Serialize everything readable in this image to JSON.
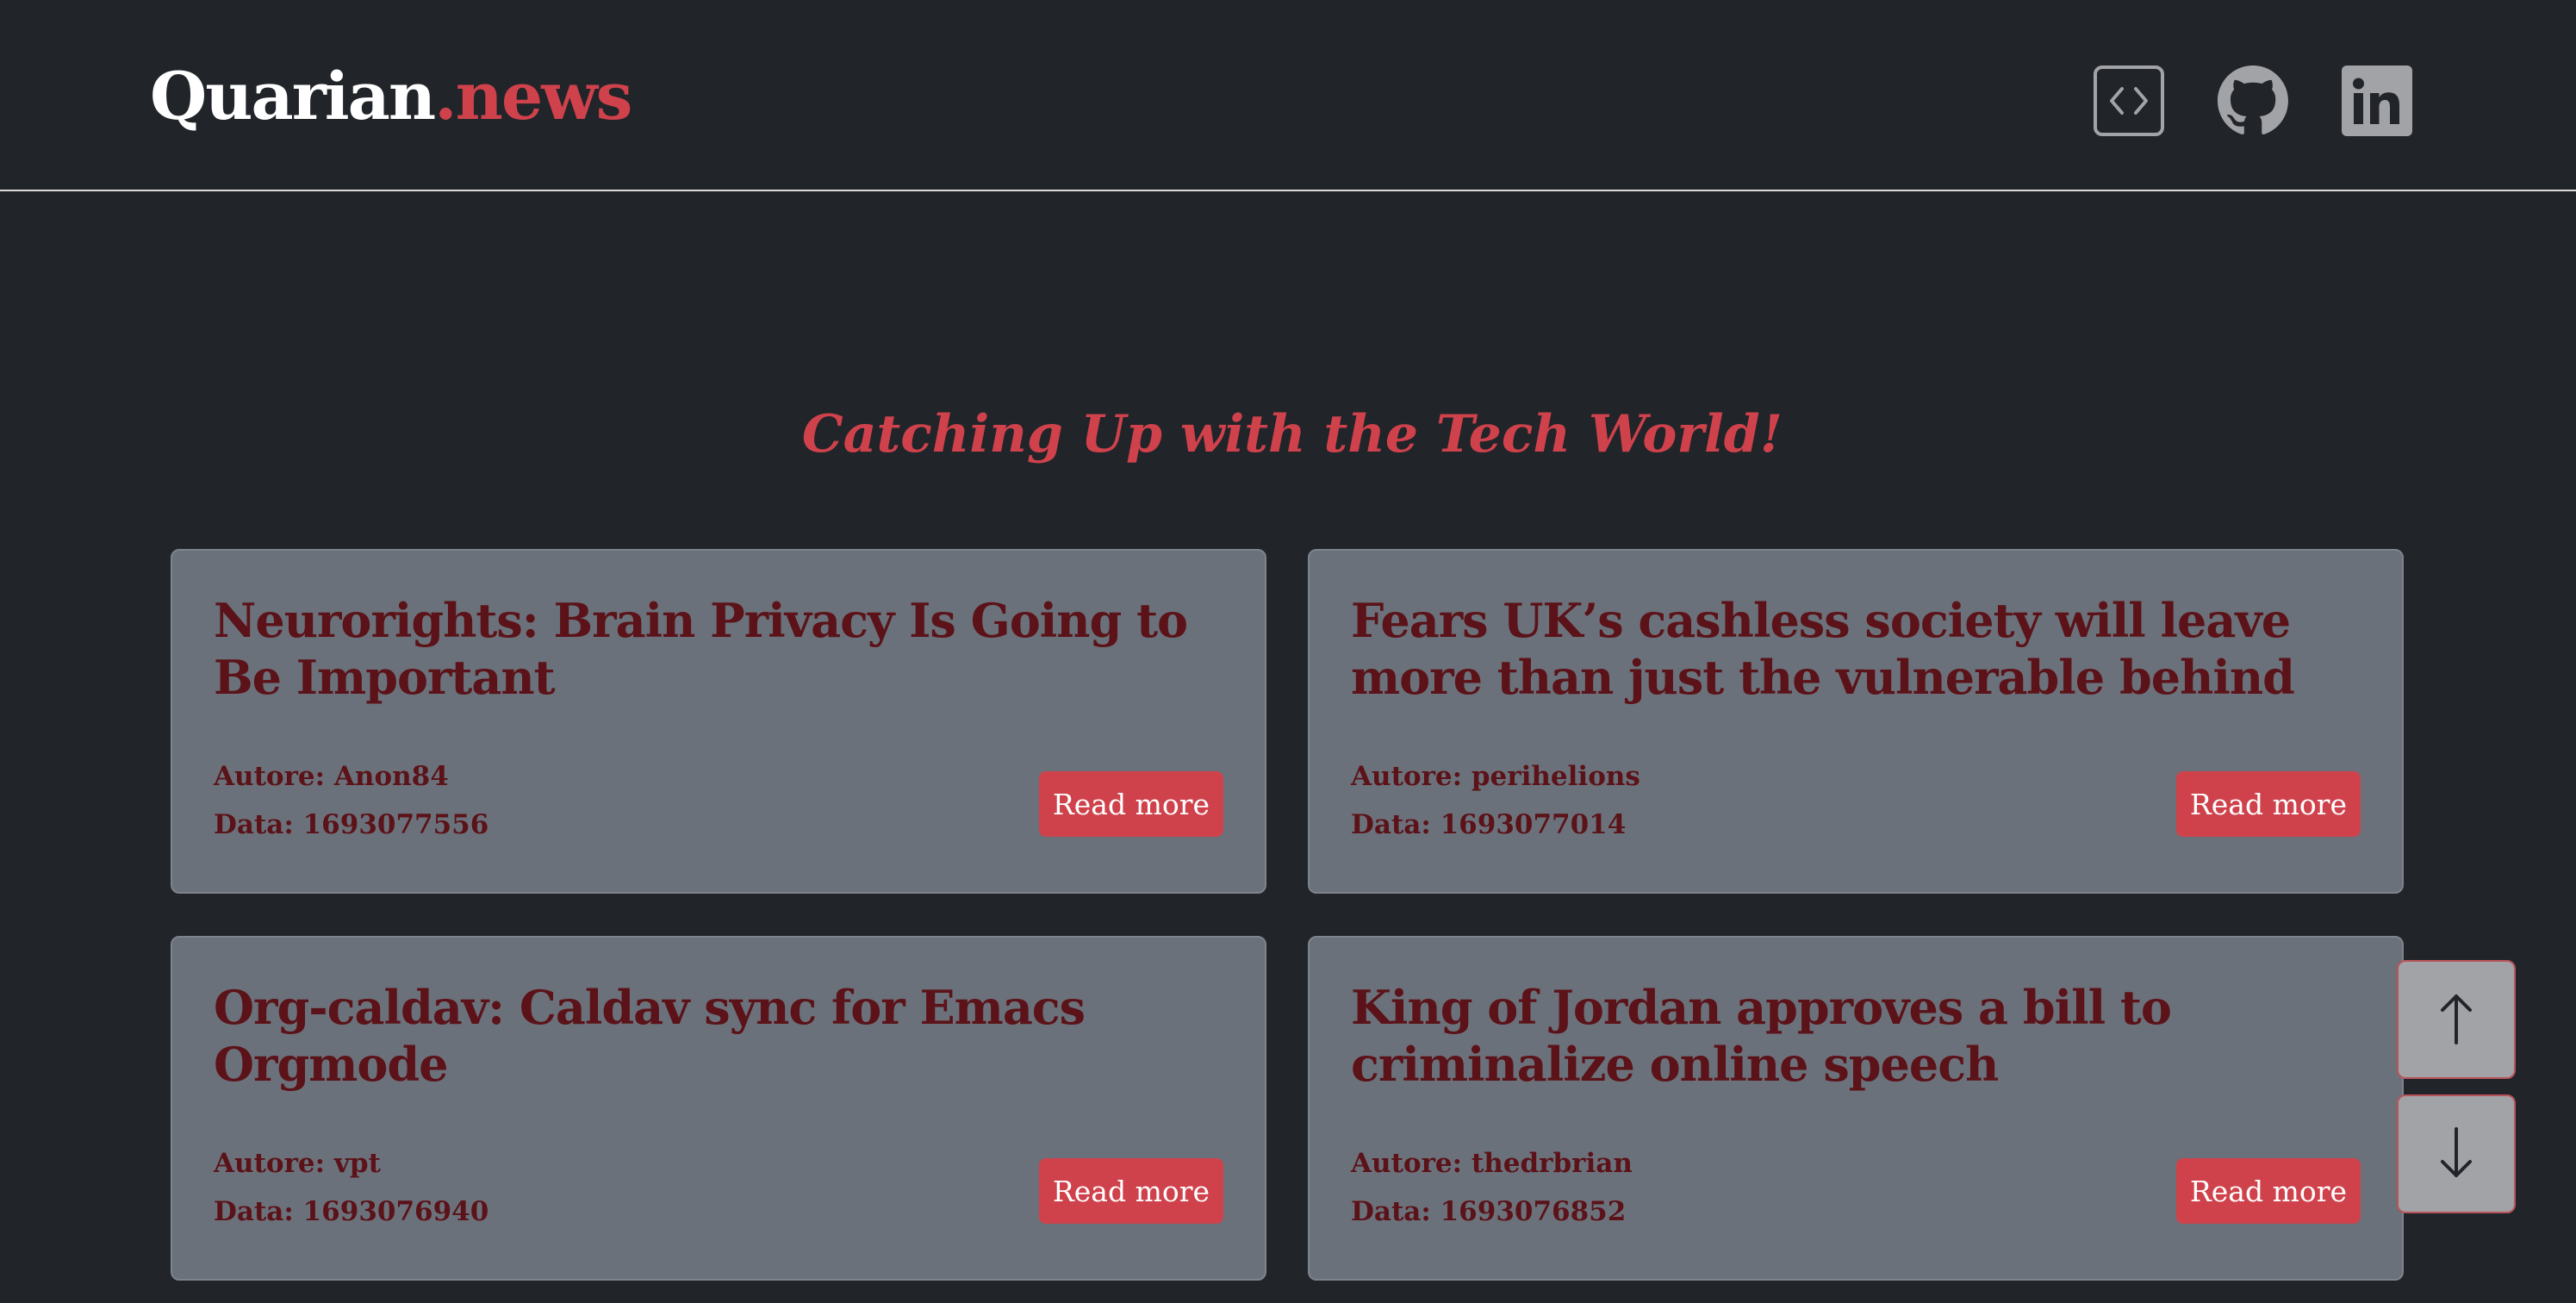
{
  "site": {
    "brand_main": "Quarian",
    "brand_tld": ".news"
  },
  "header_links": {
    "code_icon": "code-brackets-icon",
    "github_icon": "github-icon",
    "linkedin_icon": "linkedin-icon"
  },
  "tagline": "Catching Up with the Tech World!",
  "read_more_label": "Read more",
  "articles": [
    {
      "title": "Neurorights: Brain Privacy Is Going to Be Important",
      "author": "Autore: Anon84",
      "date": "Data: 1693077556"
    },
    {
      "title": "Fears UK’s cashless society will leave more than just the vulnerable behind",
      "author": "Autore: perihelions",
      "date": "Data: 1693077014"
    },
    {
      "title": "Org-caldav: Caldav sync for Emacs Orgmode",
      "author": "Autore: vpt",
      "date": "Data: 1693076940"
    },
    {
      "title": "King of Jordan approves a bill to criminalize online speech",
      "author": "Autore: thedrbrian",
      "date": "Data: 1693076852"
    }
  ],
  "scroll_controls": {
    "up_icon": "arrow-up-icon",
    "down_icon": "arrow-down-icon"
  },
  "colors": {
    "background": "#212429",
    "accent": "#cf424c",
    "card": "#6b717a",
    "card_text": "#5b1218"
  }
}
